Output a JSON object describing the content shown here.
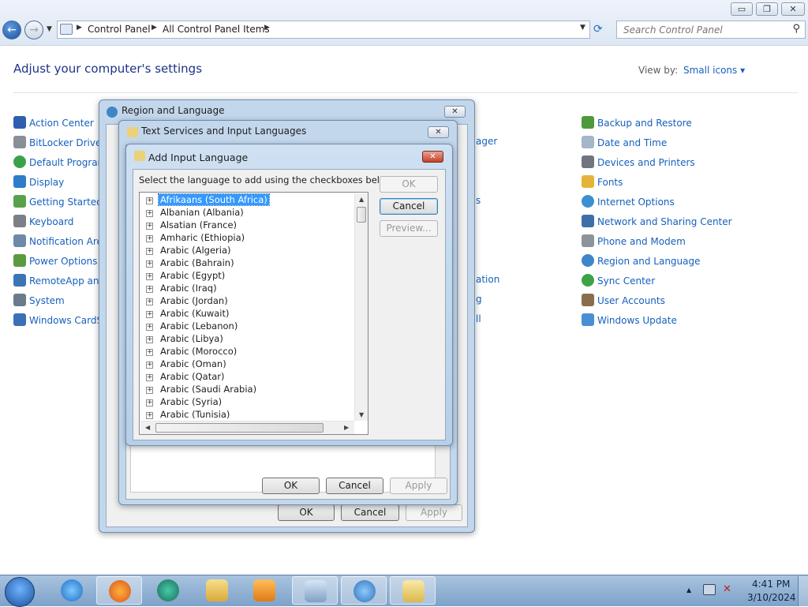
{
  "window": {
    "minimize": "▭",
    "maximize": "❐",
    "close": "✕"
  },
  "address": {
    "crumbs": [
      "Control Panel",
      "All Control Panel Items"
    ],
    "search_placeholder": "Search Control Panel"
  },
  "content": {
    "title": "Adjust your computer's settings",
    "view_by_label": "View by:",
    "view_by_value": "Small icons ▾",
    "left_items": [
      "Action Center",
      "BitLocker Drive E",
      "Default Program",
      "Display",
      "Getting Started",
      "Keyboard",
      "Notification Area",
      "Power Options",
      "RemoteApp and",
      "System",
      "Windows CardSp"
    ],
    "middle_partial": [
      "ager",
      "s",
      "ation",
      "g",
      "ll"
    ],
    "right_items": [
      "Backup and Restore",
      "Date and Time",
      "Devices and Printers",
      "Fonts",
      "Internet Options",
      "Network and Sharing Center",
      "Phone and Modem",
      "Region and Language",
      "Sync Center",
      "User Accounts",
      "Windows Update"
    ]
  },
  "dialog_region": {
    "title": "Region and Language",
    "ok": "OK",
    "cancel": "Cancel",
    "apply": "Apply"
  },
  "dialog_text_services": {
    "title": "Text Services and Input Languages",
    "ok": "OK",
    "cancel": "Cancel",
    "apply": "Apply"
  },
  "dialog_add_lang": {
    "title": "Add Input Language",
    "instruction": "Select the language to add using the checkboxes below.",
    "ok": "OK",
    "cancel": "Cancel",
    "preview": "Preview...",
    "languages": [
      "Afrikaans (South Africa)",
      "Albanian (Albania)",
      "Alsatian (France)",
      "Amharic (Ethiopia)",
      "Arabic (Algeria)",
      "Arabic (Bahrain)",
      "Arabic (Egypt)",
      "Arabic (Iraq)",
      "Arabic (Jordan)",
      "Arabic (Kuwait)",
      "Arabic (Lebanon)",
      "Arabic (Libya)",
      "Arabic (Morocco)",
      "Arabic (Oman)",
      "Arabic (Qatar)",
      "Arabic (Saudi Arabia)",
      "Arabic (Syria)",
      "Arabic (Tunisia)"
    ],
    "selected_language": "Afrikaans (South Africa)"
  },
  "taskbar": {
    "time": "4:41 PM",
    "date": "3/10/2024"
  },
  "colors": {
    "link": "#1560bd",
    "selection": "#3399ff",
    "dialog_frame": "#c3d7ec"
  }
}
